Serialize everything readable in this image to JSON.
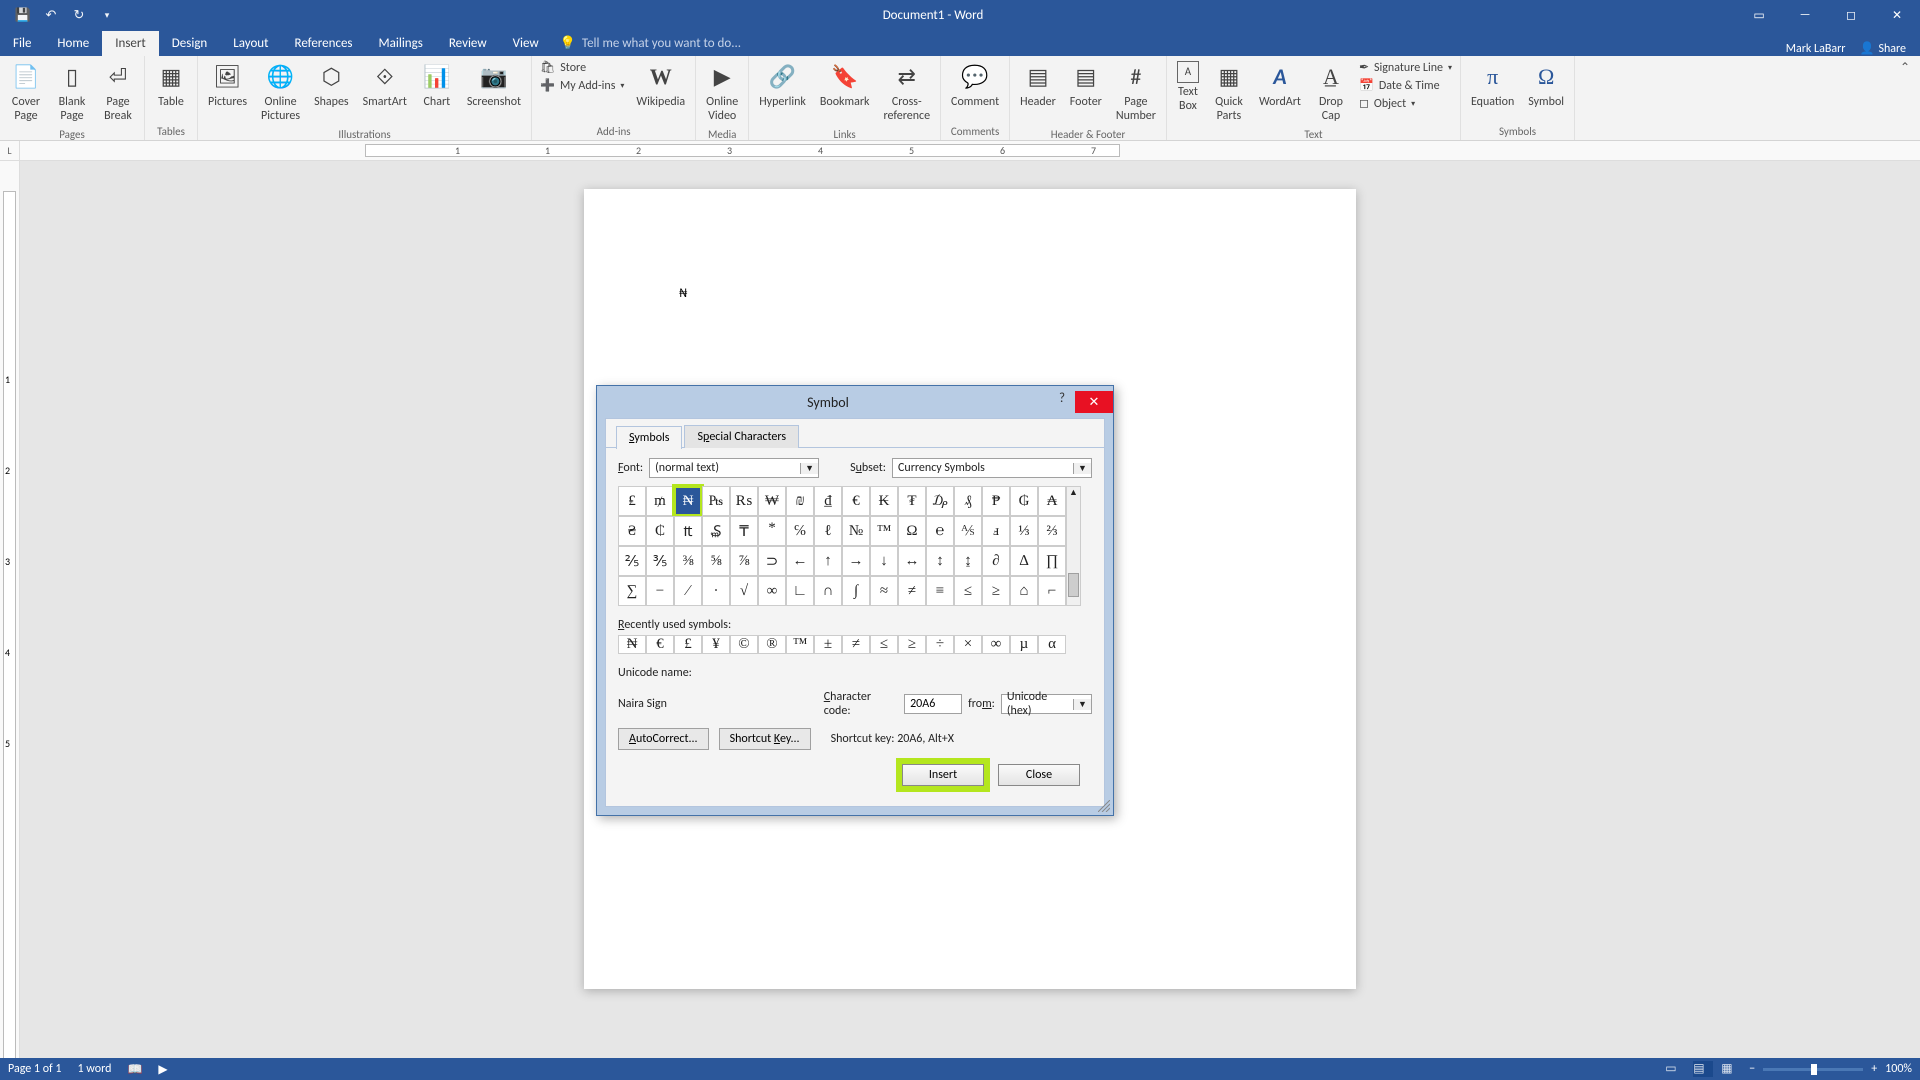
{
  "titlebar": {
    "title": "Document1 - Word"
  },
  "menubar": {
    "tabs": [
      "File",
      "Home",
      "Insert",
      "Design",
      "Layout",
      "References",
      "Mailings",
      "Review",
      "View"
    ],
    "active": "Insert",
    "tellme": "Tell me what you want to do...",
    "user": "Mark LaBarr",
    "share": "Share"
  },
  "ribbon": {
    "pages": {
      "label": "Pages",
      "cover": "Cover\nPage",
      "blank": "Blank\nPage",
      "break": "Page\nBreak"
    },
    "tables": {
      "label": "Tables",
      "table": "Table"
    },
    "illus": {
      "label": "Illustrations",
      "pics": "Pictures",
      "online": "Online\nPictures",
      "shapes": "Shapes",
      "smartart": "SmartArt",
      "chart": "Chart",
      "screenshot": "Screenshot"
    },
    "addins": {
      "label": "Add-ins",
      "store": "Store",
      "myaddins": "My Add-ins",
      "wiki": "Wikipedia"
    },
    "media": {
      "label": "Media",
      "video": "Online\nVideo"
    },
    "links": {
      "label": "Links",
      "hyper": "Hyperlink",
      "book": "Bookmark",
      "cross": "Cross-\nreference"
    },
    "comments": {
      "label": "Comments",
      "comment": "Comment"
    },
    "hf": {
      "label": "Header & Footer",
      "header": "Header",
      "footer": "Footer",
      "pg": "Page\nNumber"
    },
    "text": {
      "label": "Text",
      "tbox": "Text\nBox",
      "qp": "Quick\nParts",
      "wa": "WordArt",
      "dc": "Drop\nCap",
      "sig": "Signature Line",
      "dt": "Date & Time",
      "obj": "Object"
    },
    "symbols": {
      "label": "Symbols",
      "eq": "Equation",
      "sym": "Symbol"
    }
  },
  "doc": {
    "content": "₦"
  },
  "dialog": {
    "title": "Symbol",
    "tabs": {
      "symbols": "Symbols",
      "special": "Special Characters"
    },
    "font_label": "Font:",
    "font_val": "(normal text)",
    "subset_label": "Subset:",
    "subset_val": "Currency Symbols",
    "grid": [
      [
        "₤",
        "₥",
        "₦",
        "₧",
        "₨",
        "₩",
        "₪",
        "₫",
        "€",
        "₭",
        "₮",
        "₯",
        "₰",
        "₱",
        "₲",
        "₳"
      ],
      [
        "₴",
        "₵",
        "₶",
        "₷",
        "₸",
        "⃰",
        "℅",
        "ℓ",
        "№",
        "™",
        "Ω",
        "℮",
        "⅍",
        "ⅎ",
        "⅓",
        "⅔"
      ],
      [
        "⅖",
        "⅗",
        "⅜",
        "⅝",
        "⅞",
        "⊃",
        "←",
        "↑",
        "→",
        "↓",
        "↔",
        "↕",
        "↨",
        "∂",
        "∆",
        "∏"
      ],
      [
        "∑",
        "−",
        "∕",
        "∙",
        "√",
        "∞",
        "∟",
        "∩",
        "∫",
        "≈",
        "≠",
        "≡",
        "≤",
        "≥",
        "⌂",
        "⌐"
      ]
    ],
    "selected_row": 0,
    "selected_col": 2,
    "recent_label": "Recently used symbols:",
    "recent": [
      "₦",
      "€",
      "£",
      "¥",
      "©",
      "®",
      "™",
      "±",
      "≠",
      "≤",
      "≥",
      "÷",
      "×",
      "∞",
      "µ",
      "α"
    ],
    "unicode_label": "Unicode name:",
    "unicode_name": "Naira Sign",
    "charcode_label": "Character code:",
    "charcode_val": "20A6",
    "from_label": "from:",
    "from_val": "Unicode (hex)",
    "autocorrect": "AutoCorrect...",
    "shortcut_btn": "Shortcut Key...",
    "shortcut_label": "Shortcut key: 20A6, Alt+X",
    "insert": "Insert",
    "close": "Close"
  },
  "status": {
    "page": "Page 1 of 1",
    "words": "1 word",
    "zoom": "100%"
  },
  "ruler_h": [
    "1",
    "2",
    "3",
    "4",
    "5",
    "6",
    "7"
  ],
  "ruler_v": [
    "1",
    "2",
    "3",
    "4",
    "5"
  ]
}
